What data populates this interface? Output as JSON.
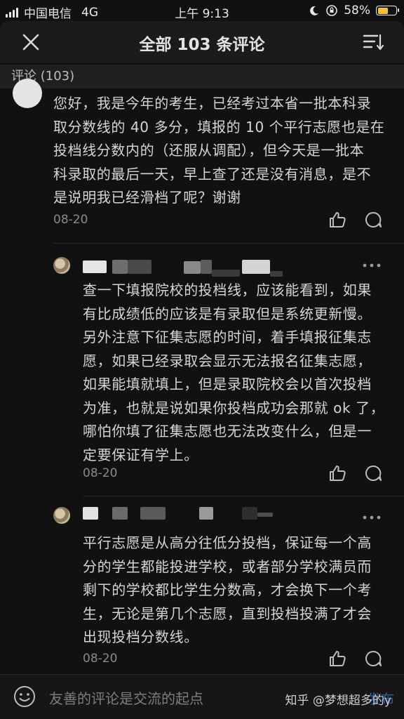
{
  "status_bar": {
    "carrier": "中国电信",
    "network": "4G",
    "time": "上午 9:13",
    "battery": "58%",
    "battery_level": 0.58
  },
  "header": {
    "title": "全部 103 条评论",
    "close_icon": "close-icon",
    "sort_icon": "sort-icon"
  },
  "section": {
    "label": "评论 (103)"
  },
  "comments": [
    {
      "lines": [
        "您好，我是今年的考生，已经考过本省一批本科录",
        "取分数线的 40 多分，填报的 10 个平行志愿也是在",
        "投档线分数内的（还服从调配），但今天是一批本",
        "科录取的最后一天，早上查了还是没有消息，是不",
        "是说明我已经滑档了呢？谢谢"
      ],
      "date": "08-20"
    },
    {
      "lines": [
        "查一下填报院校的投档线，应该能看到，如果",
        "有比成绩低的应该是有录取但是系统更新慢。",
        "另外注意下征集志愿的时间，着手填报征集志",
        "愿，如果已经录取会显示无法报名征集志愿，",
        "如果能填就填上，但是录取院校会以首次投档",
        "为准，也就是说如果你投档成功会那就 ok 了，",
        "哪怕你填了征集志愿也无法改变什么，但是一",
        "定要保证有学上。"
      ],
      "date": "08-20"
    },
    {
      "lines": [
        "平行志愿是从高分往低分投档，保证每一个高",
        "分的学生都能投进学校，或者部分学校满员而",
        "剩下的学校都比学生分数高，才会换下一个考",
        "生，无论是第几个志愿，直到投档投满了才会",
        "出现投档分数线。"
      ],
      "date": "08-20"
    }
  ],
  "bottom_bar": {
    "placeholder": "友善的评论是交流的起点",
    "publish": "发布",
    "watermark": "知乎 @梦想超多的y"
  }
}
